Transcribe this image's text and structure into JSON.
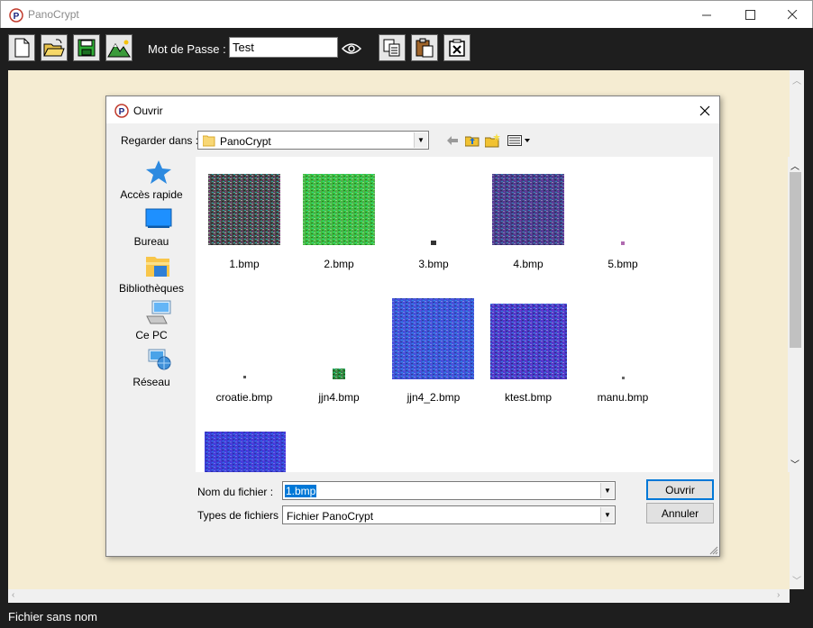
{
  "window": {
    "title": "PanoCrypt",
    "minimize_glyph": "—",
    "maximize_glyph": "☐",
    "close_glyph": "✕"
  },
  "toolbar": {
    "password_label": "Mot de Passe :",
    "password_value": "Test",
    "buttons": [
      "new-file-icon",
      "open-folder-icon",
      "save-icon",
      "image-icon",
      "eye-icon",
      "copy-icon",
      "paste-icon",
      "clear-icon"
    ]
  },
  "status": {
    "text": "Fichier sans nom"
  },
  "dialog": {
    "title": "Ouvrir",
    "look_in_label": "Regarder dans :",
    "look_in_value": "PanoCrypt",
    "places": [
      {
        "label": "Accès rapide",
        "icon": "star-icon"
      },
      {
        "label": "Bureau",
        "icon": "desktop-icon"
      },
      {
        "label": "Bibliothèques",
        "icon": "libraries-icon"
      },
      {
        "label": "Ce PC",
        "icon": "computer-icon"
      },
      {
        "label": "Réseau",
        "icon": "network-icon"
      }
    ],
    "files": [
      {
        "name": "1.bmp"
      },
      {
        "name": "2.bmp"
      },
      {
        "name": "3.bmp"
      },
      {
        "name": "4.bmp"
      },
      {
        "name": "5.bmp"
      },
      {
        "name": "croatie.bmp"
      },
      {
        "name": "jjn4.bmp"
      },
      {
        "name": "jjn4_2.bmp"
      },
      {
        "name": "ktest.bmp"
      },
      {
        "name": "manu.bmp"
      },
      {
        "name": ""
      }
    ],
    "file_name_label": "Nom du fichier :",
    "file_name_value": "1.bmp",
    "file_type_label": "Types de fichiers :",
    "file_type_value": "Fichier PanoCrypt",
    "open_button": "Ouvrir",
    "cancel_button": "Annuler"
  }
}
